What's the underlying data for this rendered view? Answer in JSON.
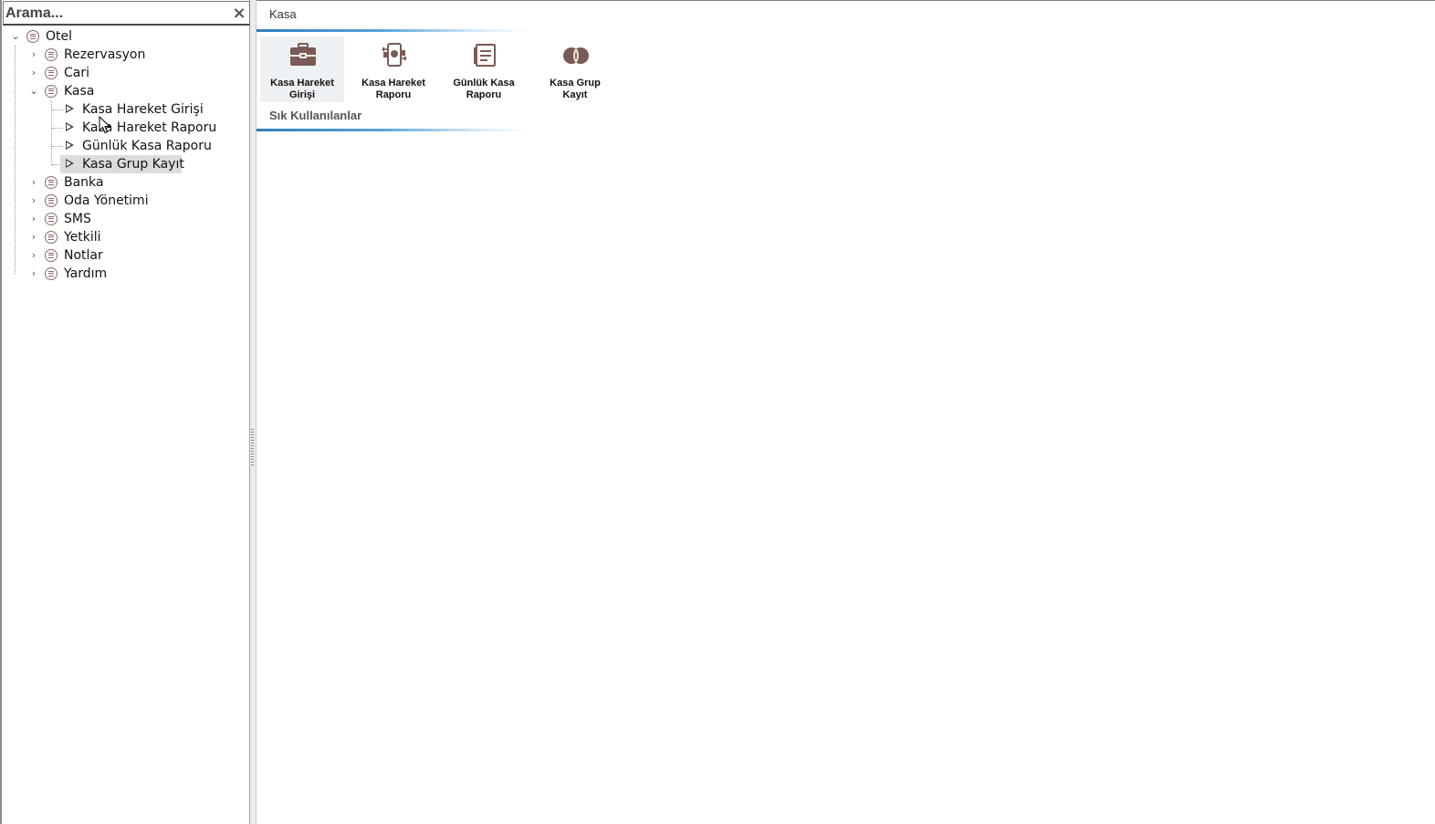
{
  "search": {
    "placeholder": "Arama...",
    "clear_label": "×"
  },
  "tree": {
    "root": "Otel",
    "items": [
      {
        "label": "Rezervasyon"
      },
      {
        "label": "Cari"
      },
      {
        "label": "Kasa",
        "children": [
          {
            "label": "Kasa Hareket Girişi"
          },
          {
            "label": "Kasa Hareket Raporu"
          },
          {
            "label": "Günlük Kasa Raporu"
          },
          {
            "label": "Kasa Grup Kayıt"
          }
        ]
      },
      {
        "label": "Banka"
      },
      {
        "label": "Oda Yönetimi"
      },
      {
        "label": "SMS"
      },
      {
        "label": "Yetkili"
      },
      {
        "label": "Notlar"
      },
      {
        "label": "Yardım"
      }
    ]
  },
  "main": {
    "group_title": "Kasa",
    "tiles": [
      {
        "label_line1": "Kasa Hareket",
        "label_line2": "Girişi",
        "icon": "briefcase-icon"
      },
      {
        "label_line1": "Kasa Hareket",
        "label_line2": "Raporu",
        "icon": "cash-flow-icon"
      },
      {
        "label_line1": "Günlük Kasa",
        "label_line2": "Raporu",
        "icon": "daily-report-icon"
      },
      {
        "label_line1": "Kasa Grup",
        "label_line2": "Kayıt",
        "icon": "coins-icon"
      }
    ],
    "frequent_title": "Sık Kullanılanlar"
  },
  "colors": {
    "accent": "#2c7fbf",
    "icon": "#7a5a56",
    "selected_bg": "#dcdcdc"
  }
}
